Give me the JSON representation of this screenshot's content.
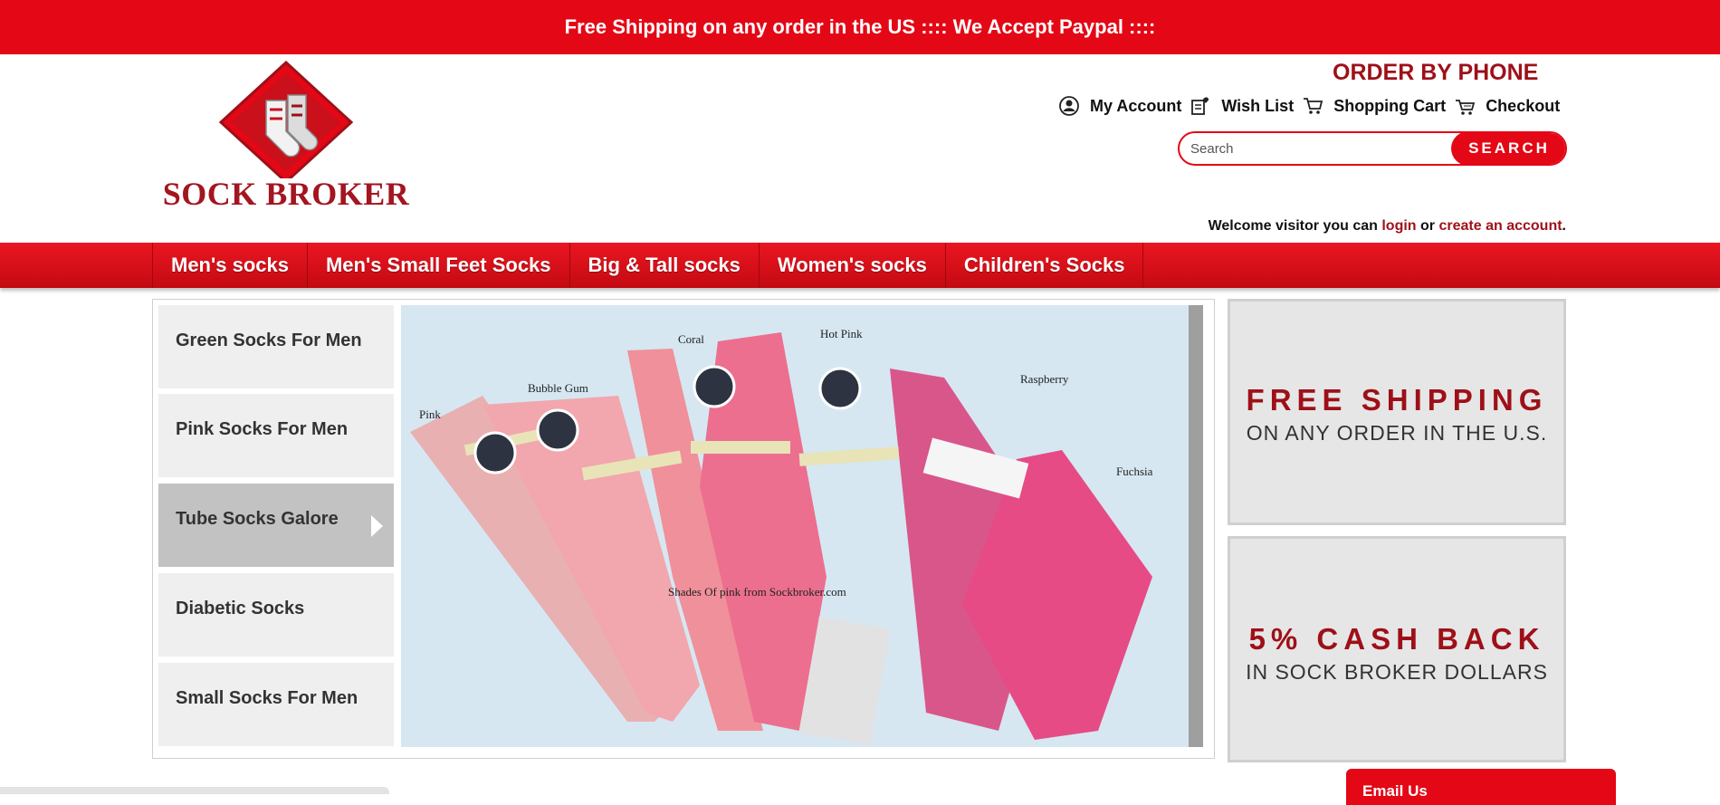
{
  "announcement": "Free Shipping on any order in the US :::: We Accept Paypal ::::",
  "brand": {
    "logo_text": "SOCK BROKER"
  },
  "header": {
    "order_by_phone": "ORDER BY PHONE",
    "links": [
      {
        "label": "My Account",
        "icon": "user-icon"
      },
      {
        "label": "Wish List",
        "icon": "wishlist-icon"
      },
      {
        "label": "Shopping Cart",
        "icon": "cart-icon"
      },
      {
        "label": "Checkout",
        "icon": "checkout-cart-icon"
      }
    ],
    "search": {
      "placeholder": "Search",
      "button": "SEARCH"
    },
    "welcome": {
      "prefix": "Welcome visitor you can",
      "login": "login",
      "or": "or",
      "create": "create an account",
      "suffix": "."
    }
  },
  "nav": [
    {
      "label": "Men's socks"
    },
    {
      "label": "Men's Small Feet Socks"
    },
    {
      "label": "Big & Tall socks"
    },
    {
      "label": "Women's socks"
    },
    {
      "label": "Children's Socks"
    }
  ],
  "slider": {
    "items": [
      {
        "label": "Green Socks For Men",
        "active": false
      },
      {
        "label": "Pink Socks For Men",
        "active": false
      },
      {
        "label": "Tube Socks Galore",
        "active": true
      },
      {
        "label": "Diabetic Socks",
        "active": false
      },
      {
        "label": "Small Socks For Men",
        "active": false
      }
    ],
    "slide": {
      "sock_labels": [
        "Pink",
        "Bubble Gum",
        "Coral",
        "Hot Pink",
        "Raspberry",
        "Fuchsia"
      ],
      "caption": "Shades Of pink from Sockbroker.com"
    }
  },
  "promos": [
    {
      "big": "FREE SHIPPING",
      "small": "ON ANY ORDER IN THE U.S."
    },
    {
      "big": "5% CASH BACK",
      "small": "IN SOCK BROKER DOLLARS"
    }
  ],
  "email_tab": "Email Us",
  "colors": {
    "brand_red": "#e40716",
    "dark_red": "#9e1018"
  }
}
